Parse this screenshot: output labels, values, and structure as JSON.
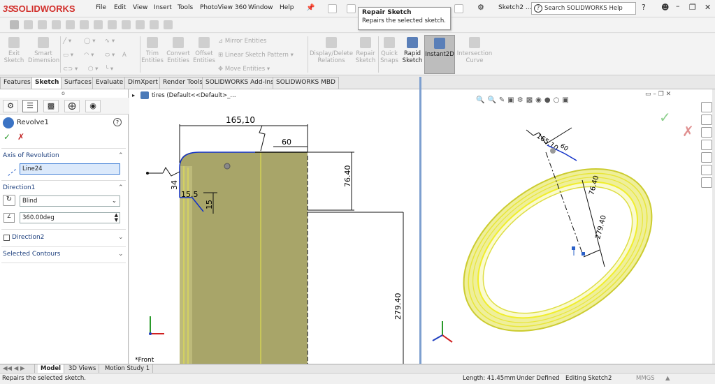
{
  "app": {
    "name": "SOLIDWORKS",
    "doc_name": "Sketch2 ..."
  },
  "menu": [
    "File",
    "Edit",
    "View",
    "Insert",
    "Tools",
    "PhotoView 360",
    "Window",
    "Help"
  ],
  "search": {
    "placeholder": "Search SOLIDWORKS Help"
  },
  "tooltip": {
    "title": "Repair Sketch",
    "text": "Repairs the selected sketch."
  },
  "commands": [
    {
      "label": "Exit\nSketch"
    },
    {
      "label": "Smart\nDimension"
    },
    {
      "label": "Trim\nEntities"
    },
    {
      "label": "Convert\nEntities"
    },
    {
      "label": "Offset\nEntities"
    },
    {
      "label": "Display/Delete\nRelations"
    },
    {
      "label": "Repair\nSketch"
    },
    {
      "label": "Quick\nSnaps"
    },
    {
      "label": "Rapid\nSketch"
    },
    {
      "label": "Instant2D"
    },
    {
      "label": "Intersection\nCurve"
    }
  ],
  "small_cmds": [
    "Mirror Entities",
    "Linear Sketch Pattern",
    "Move Entities"
  ],
  "tabs": [
    "Features",
    "Sketch",
    "Surfaces",
    "Evaluate",
    "DimXpert",
    "Render Tools",
    "SOLIDWORKS Add-Ins",
    "SOLIDWORKS MBD"
  ],
  "active_tab": "Sketch",
  "property_manager": {
    "feature": "Revolve1",
    "axis_section": "Axis of Revolution",
    "axis_value": "Line24",
    "direction1_section": "Direction1",
    "end_condition": "Blind",
    "angle": "360.00deg",
    "direction2_section": "Direction2",
    "contours_section": "Selected Contours"
  },
  "tree": {
    "item": "tires  (Default<<Default>_..."
  },
  "left_view": {
    "dims": [
      "165,10",
      "60",
      "76.40",
      "34",
      "15.5",
      "15",
      "279.40"
    ],
    "label": "*Front"
  },
  "right_view": {
    "dims": [
      "165,10",
      "60",
      "76.40",
      "279.40"
    ]
  },
  "bottom_tabs": [
    "Model",
    "3D Views",
    "Motion Study 1"
  ],
  "status": {
    "message": "Repairs the selected sketch.",
    "length": "Length: 41.45mm",
    "state": "Under Defined",
    "editing": "Editing Sketch2",
    "units": "MMGS"
  },
  "colors": {
    "accent": "#2a60c8",
    "part_fill": "#a8a569",
    "edge": "#f0ee2c",
    "logo": "#d2302c"
  }
}
